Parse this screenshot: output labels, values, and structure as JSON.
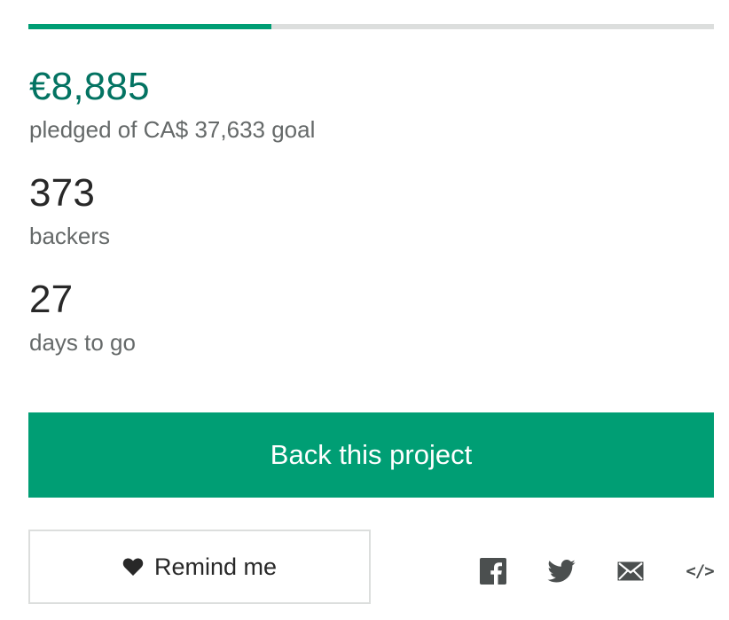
{
  "funding": {
    "progress_fraction": 0.355,
    "progress_color": "#009e74",
    "pledged_amount": "€8,885",
    "pledged_label": "pledged of CA$ 37,633 goal",
    "pledged_color": "#037362"
  },
  "backers": {
    "count": "373",
    "label": "backers"
  },
  "duration": {
    "days": "27",
    "label": "days to go"
  },
  "actions": {
    "back_label": "Back this project",
    "remind_label": "Remind me",
    "remind_icon": "heart-icon"
  },
  "share": {
    "icons": [
      "facebook-icon",
      "twitter-icon",
      "email-icon",
      "embed-icon"
    ],
    "embed_glyph": "</>"
  }
}
